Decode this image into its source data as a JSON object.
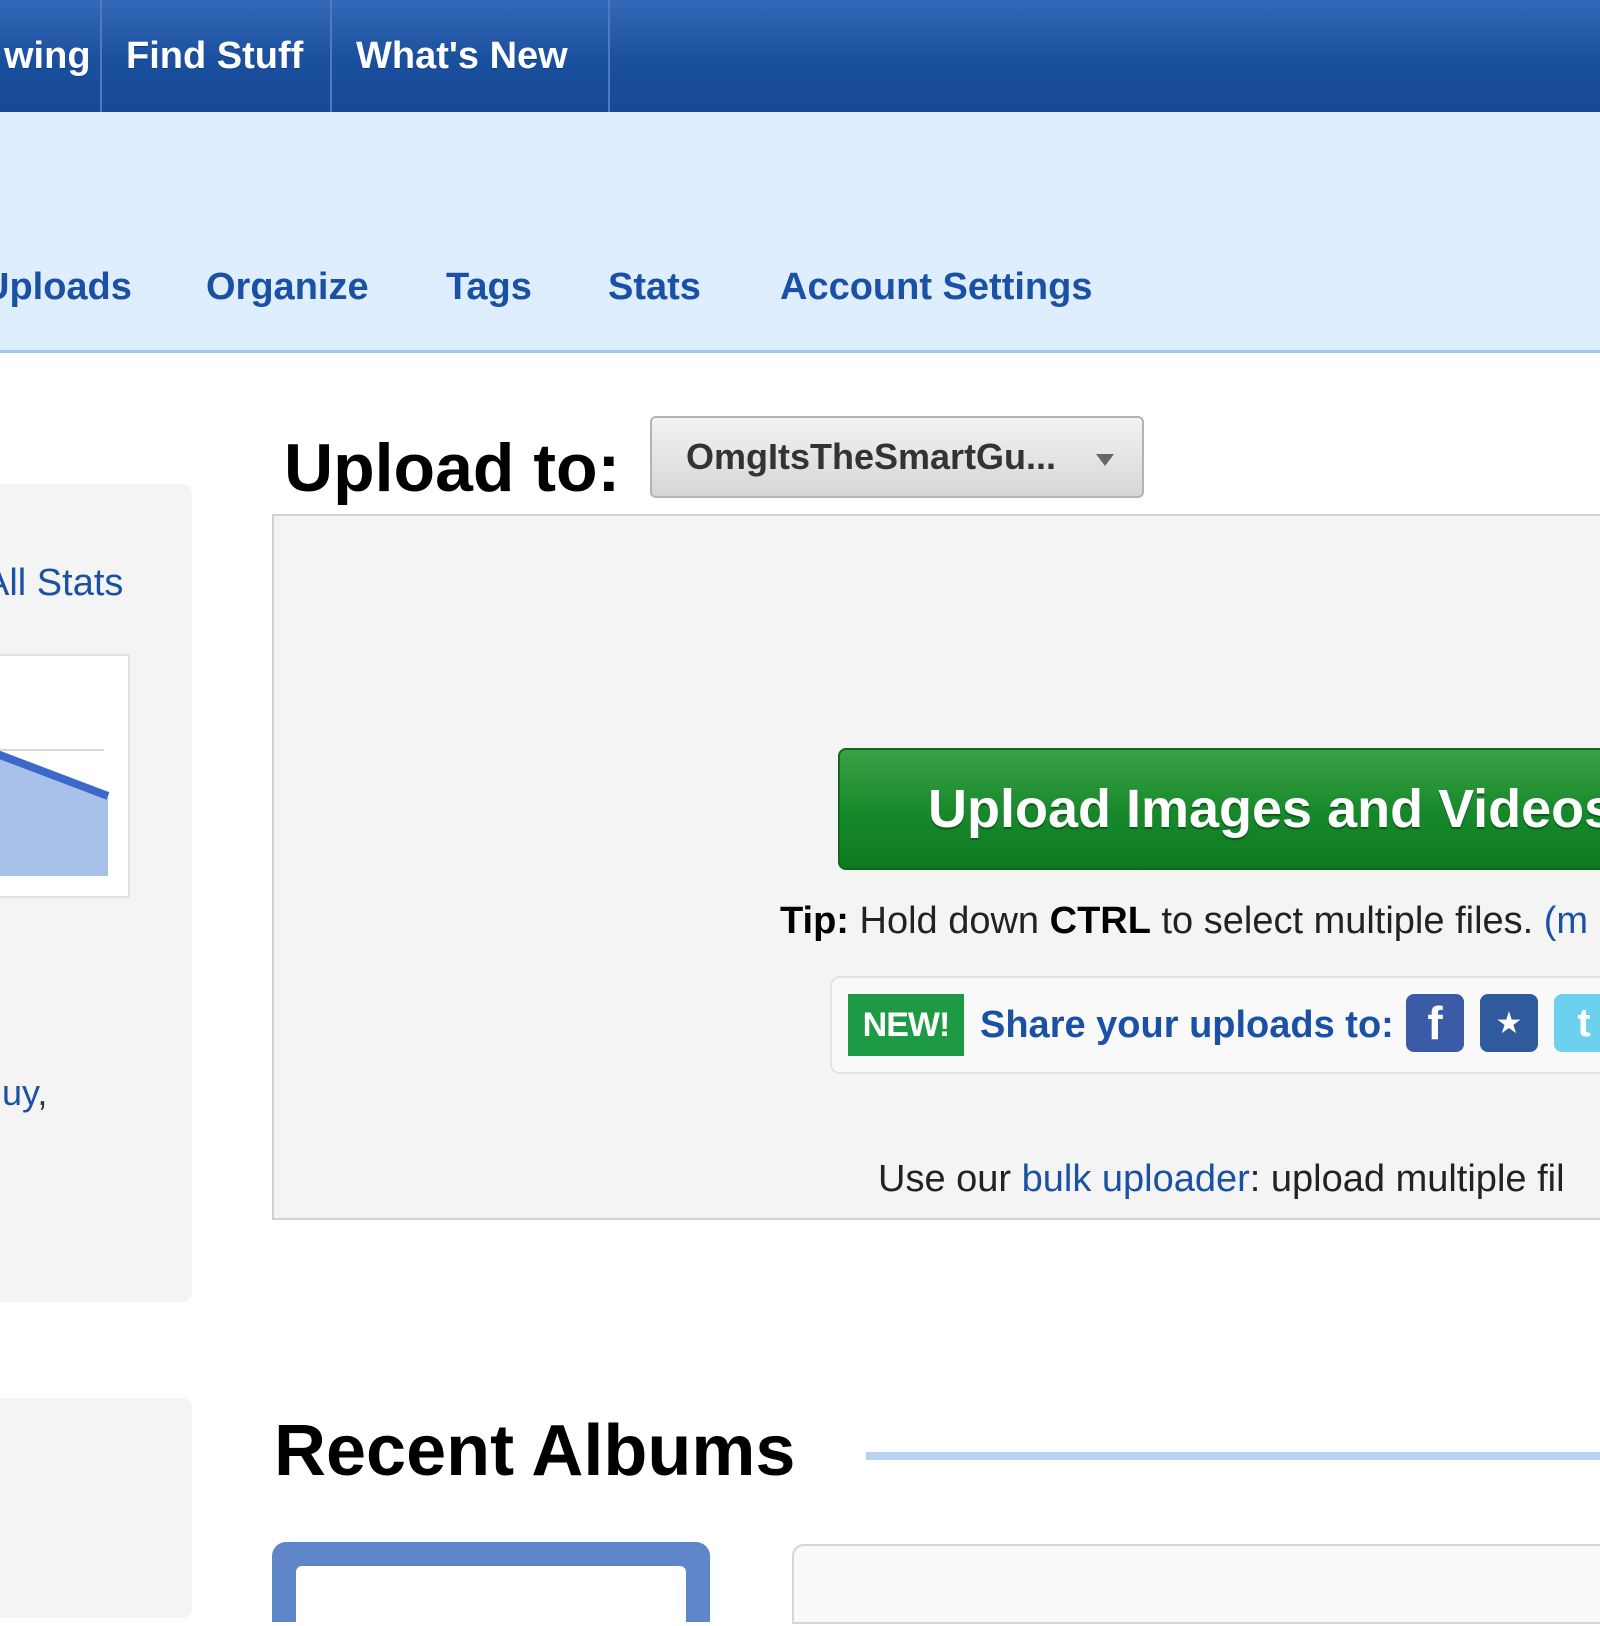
{
  "top_nav": {
    "tabs": [
      {
        "label": "wing"
      },
      {
        "label": "Find Stuff"
      },
      {
        "label": "What's New"
      }
    ]
  },
  "sub_nav": {
    "items": [
      {
        "label": "Uploads"
      },
      {
        "label": "Organize"
      },
      {
        "label": "Tags"
      },
      {
        "label": "Stats"
      },
      {
        "label": "Account Settings"
      }
    ]
  },
  "sidebar": {
    "stats_link": "All Stats",
    "user_snippet": "uy",
    "user_snippet_punct": ",",
    "chart_color": "#3c69c9",
    "chart_fill": "#a8c1ea"
  },
  "upload": {
    "label": "Upload to:",
    "destination": "OmgItsTheSmartGu...",
    "button_label": "Upload Images and Videos",
    "tip_prefix": "Tip:",
    "tip_text_1": " Hold down ",
    "tip_key": "CTRL",
    "tip_text_2": " to select multiple files. ",
    "tip_more": "(m",
    "share_badge": "NEW!",
    "share_text": "Share your uploads to:",
    "social_icons": [
      "facebook-icon",
      "myspace-icon",
      "twitter-icon"
    ],
    "bulk_prefix": "Use our ",
    "bulk_link": "bulk uploader",
    "bulk_suffix": ": upload multiple fil"
  },
  "recent_albums": {
    "title": "Recent Albums"
  }
}
